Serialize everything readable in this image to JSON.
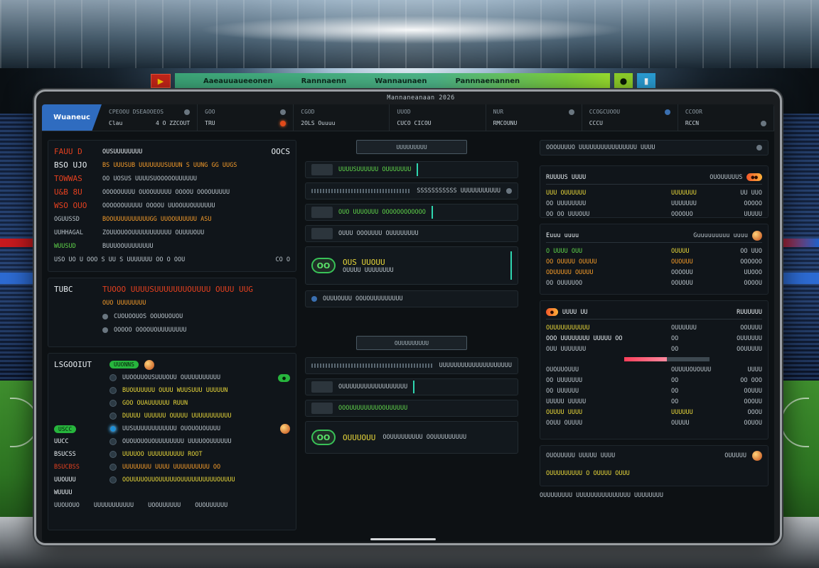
{
  "score_bar": {
    "flag_icon": "flag-icon",
    "items": [
      "Aaeauuaueeonen",
      "Rannnaenn",
      "Wannaunaen",
      "Pannnaenannen"
    ],
    "chip_icons": [
      "notification-icon",
      "stats-icon"
    ]
  },
  "screen": {
    "notch_label": "Mannaneanaan 2026"
  },
  "nav": {
    "brand": "Wuaneuc",
    "groups": [
      {
        "top": "CPEOOU DSEAOOEOS",
        "bottom_left": "Clau",
        "bottom_right": "4 O ZZCOUT"
      },
      {
        "top": "GOO",
        "bottom_left": "TRU",
        "bottom_right": ""
      },
      {
        "top": "CGOD",
        "bottom_left": "2OLS Ouuuu",
        "bottom_right": ""
      },
      {
        "top": "UUOD",
        "bottom_left": "CUCO CICOU",
        "bottom_right": ""
      },
      {
        "top": "NUR",
        "bottom_left": "RMCOUNU",
        "bottom_right": ""
      },
      {
        "top": "CCOGCUOOU",
        "bottom_left": "CCCU",
        "bottom_right": ""
      },
      {
        "top": "CCOOR",
        "bottom_left": "RCCN",
        "bottom_right": ""
      }
    ]
  },
  "left": {
    "header": {
      "k": "FAUU D",
      "v": "OUSUUUUUUUU",
      "r": "OOCS"
    },
    "rows": [
      {
        "k": "BSO UJO",
        "v": "BS UUUSUB UUUUUUUSUUUN S UUNG GG UUGS",
        "r": ""
      },
      {
        "k": "TOWWAS",
        "v": "OO UOSUS UUUUSUOOOOOUUUUUU",
        "r": ""
      },
      {
        "k": "U&B 8U",
        "v": "OOOOOUUUU OUOOUUUUU OOOOU OOOOUUUUU",
        "r": ""
      },
      {
        "k": "WSO OUO",
        "v": "OOOOOOUUUUU OOOOU UUOOUUOUUUUUU",
        "r": ""
      },
      {
        "k": "OGUUSSD",
        "v": "BOOUUUUUUUUUUGG UUOOUUUUUU ASU",
        "r": ""
      },
      {
        "k": "UUHHAGAL",
        "v": "ZOUUOUOOUUUUUUUUUUU OUUUUOUU",
        "r": ""
      },
      {
        "k": "WUUSUD",
        "v": "BUUUOOUUUUUUUU",
        "r": ""
      }
    ],
    "footer": "USO UO U OOO S UU S UUUUUUU OO O OOU",
    "footer_r": "CO O",
    "promo_title": "TUBC",
    "promo_line1": "TUOOO UUUUSUUUUUUUOUUUU OUUU UUG",
    "promo_line2": "OUO UUUUUUUU",
    "promo_items": [
      "CUOUOOUOS OOUOUOUOU",
      "OOOOO OOOOUOUUUUUUUU"
    ],
    "section_label": "LSGOOIUT",
    "section_pill": "UUONNS",
    "live_matches": [
      {
        "name": "UUOOUUOUSUUUOUU OUUUUUUUUUU",
        "pill": ""
      },
      {
        "name": "BUOUUUUUU OUUU WUUSUUU UUUUUN",
        "pill": ""
      },
      {
        "name": "GOO OUAUUUUUU RUUN",
        "pill": ""
      },
      {
        "name": "DUUUU UUUUUU OUUUU UUUUUUUUUUU",
        "pill": ""
      },
      {
        "name": "UUSUUUUUUUUUUUU OUOUOUOUUUU",
        "pill": ""
      }
    ],
    "side_tags": [
      "UUCC",
      "BSUCSS",
      "BSUCBSS",
      "UUOUUU",
      "WUUUU"
    ],
    "side_badge": "USCC",
    "bottom_rows": [
      "OUOUOUOUOUUUUUUUU UUUUOOUUUUUU",
      "UUUUOO UUUUUUUUUU ROOT",
      "UUUUUUUU UUUU UUUUUUUUUU OO",
      "OOUUUUOUUOUUUUUOUUUUUUUUUUOUUUU"
    ],
    "bottom_footer": [
      "UUOUOUO",
      "UUUUUUUUUUU",
      "UOOUUUUUU",
      "OUOUUUUUU"
    ]
  },
  "mid": {
    "search_top": "UUUUUUUUU",
    "tickers": [
      "UUUUSUUUUUU OUUUUUUU",
      "SSSSSSSSSSS UUUUUUUUUUU",
      "OUO UUUOUUU OOOOOOOOOOOO",
      "OUUU OOOUUUU OUUUUUUUU",
      "OUUUOUUU OOUOUUUUUUUUU"
    ],
    "feature_logo": "OO",
    "feature_title": "OUS UUOUU",
    "feature_sub": "OUUUU UUUUUUUU",
    "search_mid": "OUUUUUUUUU",
    "tickers2": [
      "UUUUUUUUUUUUUUUUUUUU",
      "OUUUUUUUUUUUUUUUUUU",
      "OOOUUUUUUUUOOUUUUUU",
      "OOUUUUUUUUU OOUUUUUUUUU"
    ],
    "feature2_logo": "OO",
    "feature2_title": "OUUUOUU"
  },
  "right": {
    "search": "OOOUUUUO UUUUUUUUUUUUUUUU UUUU",
    "t1": {
      "title": "RUUUUS UUUU",
      "right": "OUOUUUUUS",
      "rows": [
        {
          "a": "UUU OUUUUUU",
          "b": "UUUUUUU",
          "c": "UU UUO"
        },
        {
          "a": "OO UUUUUUUU",
          "b": "UUUUUUU",
          "c": "OOOOO"
        },
        {
          "a": "OO OO UUUOUU",
          "b": "OOOOUO",
          "c": "UUUUU"
        }
      ]
    },
    "t2": {
      "title": "Euuu uuuu",
      "right": "Guuuuuuuuu uuuu",
      "rows": [
        {
          "a": "O UUUU OUU",
          "b": "OUUUU",
          "c": "OO UUO"
        },
        {
          "a": "OO OUUUU OUUUU",
          "b": "OUOUUU",
          "c": "OOOOOO"
        },
        {
          "a": "ODUUUUU OUUUU",
          "b": "OOOOUU",
          "c": "UUOOO"
        },
        {
          "a": "OO OUUUUOO",
          "b": "OOUOUU",
          "c": "OOOOU"
        }
      ]
    },
    "t3": {
      "title": "UUUU UU",
      "right": "RUUUUUU",
      "rows": [
        {
          "a": "OUUUUUUUUUUU",
          "b": "OUUUUUU",
          "c": "OOUUUU"
        },
        {
          "a": "OOO UUUUUUUU UUUUU OO",
          "b": "OO",
          "c": "OUUUUUU"
        },
        {
          "a": "OUU UUUUUUU",
          "b": "OO",
          "c": "OOUUUUU"
        },
        {
          "a": "OUOUUOUUU",
          "b": "OUUUUOUOUUU",
          "c": "UUUU"
        },
        {
          "a": "OO UUUUUUU",
          "b": "OO",
          "c": "OO OOO"
        },
        {
          "a": "OO UUUUUU",
          "b": "OO",
          "c": "OOUUU"
        },
        {
          "a": "UUUUU UUUUU",
          "b": "OO",
          "c": "OOOUU"
        },
        {
          "a": "OUUUU UUUU",
          "b": "UUUUUU",
          "c": "OOOU"
        },
        {
          "a": "OOUU OUUUU",
          "b": "OUUUU",
          "c": "OOUOU"
        }
      ]
    },
    "footer1": "OUOUUUUU UUUUU UUUU",
    "footer1_r": "OUUUUU",
    "footer2": "OUUUUUUUUU O OUUUU OUUU",
    "bottom": "OUUUUUUUU UUUUUUUUUUUUUUU UUUUUUUU"
  }
}
